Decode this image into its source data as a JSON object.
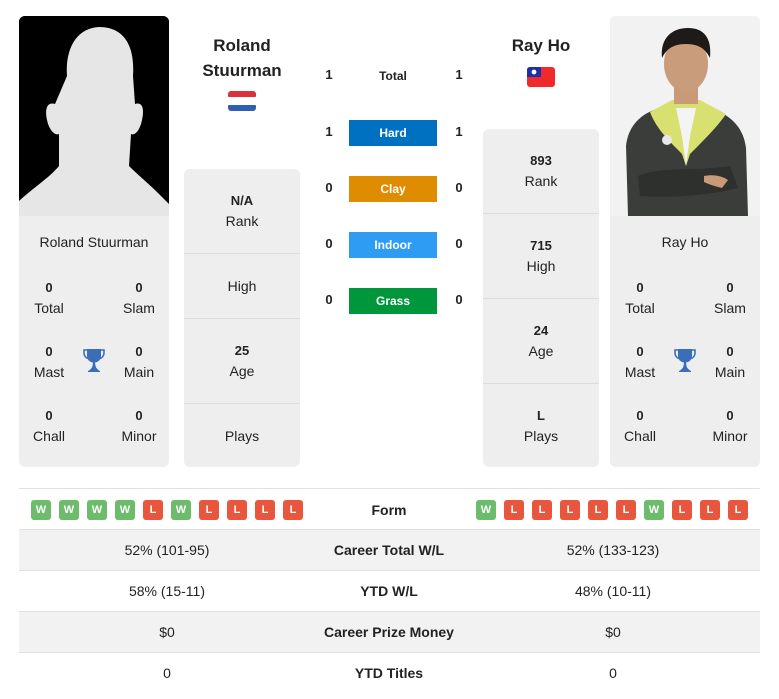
{
  "players": {
    "left": {
      "name": "Roland Stuurman",
      "name_line1": "Roland",
      "name_line2": "Stuurman",
      "country": "Netherlands",
      "flag_icon": "netherlands-flag",
      "photo": "silhouette-placeholder",
      "titles": {
        "total": {
          "value": "0",
          "label": "Total"
        },
        "slam": {
          "value": "0",
          "label": "Slam"
        },
        "mast": {
          "value": "0",
          "label": "Mast"
        },
        "main": {
          "value": "0",
          "label": "Main"
        },
        "chall": {
          "value": "0",
          "label": "Chall"
        },
        "minor": {
          "value": "0",
          "label": "Minor"
        }
      },
      "info": [
        {
          "value": "N/A",
          "label": "Rank"
        },
        {
          "value": "",
          "label": "High"
        },
        {
          "value": "25",
          "label": "Age"
        },
        {
          "value": "",
          "label": "Plays"
        }
      ]
    },
    "right": {
      "name": "Ray Ho",
      "country": "Taiwan",
      "flag_icon": "taiwan-flag",
      "photo": "player-photo",
      "titles": {
        "total": {
          "value": "0",
          "label": "Total"
        },
        "slam": {
          "value": "0",
          "label": "Slam"
        },
        "mast": {
          "value": "0",
          "label": "Mast"
        },
        "main": {
          "value": "0",
          "label": "Main"
        },
        "chall": {
          "value": "0",
          "label": "Chall"
        },
        "minor": {
          "value": "0",
          "label": "Minor"
        }
      },
      "info": [
        {
          "value": "893",
          "label": "Rank"
        },
        {
          "value": "715",
          "label": "High"
        },
        {
          "value": "24",
          "label": "Age"
        },
        {
          "value": "L",
          "label": "Plays"
        }
      ]
    }
  },
  "h2h": [
    {
      "surface": "Total",
      "left": "1",
      "right": "1",
      "color": ""
    },
    {
      "surface": "Hard",
      "left": "1",
      "right": "1",
      "color": "#0070c0"
    },
    {
      "surface": "Clay",
      "left": "0",
      "right": "0",
      "color": "#e08c00"
    },
    {
      "surface": "Indoor",
      "left": "0",
      "right": "0",
      "color": "#2e9cf2"
    },
    {
      "surface": "Grass",
      "left": "0",
      "right": "0",
      "color": "#00963c"
    }
  ],
  "form": {
    "label": "Form",
    "left": [
      "W",
      "W",
      "W",
      "W",
      "L",
      "W",
      "L",
      "L",
      "L",
      "L"
    ],
    "right": [
      "W",
      "L",
      "L",
      "L",
      "L",
      "L",
      "W",
      "L",
      "L",
      "L"
    ]
  },
  "stats": [
    {
      "label": "Career Total W/L",
      "left": "52% (101-95)",
      "right": "52% (133-123)"
    },
    {
      "label": "YTD W/L",
      "left": "58% (15-11)",
      "right": "48% (10-11)"
    },
    {
      "label": "Career Prize Money",
      "left": "$0",
      "right": "$0"
    },
    {
      "label": "YTD Titles",
      "left": "0",
      "right": "0"
    }
  ],
  "colors": {
    "win": "#6cbc6c",
    "loss": "#e8563e",
    "trophy": "#3a6fb8",
    "card_bg": "#eeeeee"
  }
}
